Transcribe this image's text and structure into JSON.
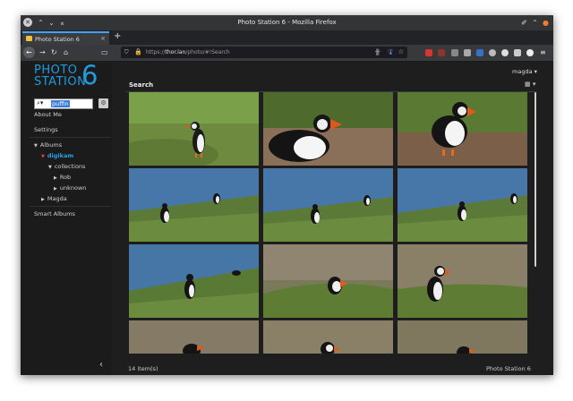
{
  "window": {
    "title": "Photo Station 6 - Mozilla Firefox"
  },
  "browser": {
    "tab_label": "Photo Station 6",
    "tab_close": "×",
    "new_tab": "+",
    "url_prefix": "https://",
    "url_host": "thor.lan",
    "url_path": "/photo/#!Search",
    "icons": [
      "back-icon",
      "forward-icon",
      "reload-icon",
      "home-icon",
      "reader-icon",
      "shield-icon",
      "lock-icon",
      "page-actions-icon",
      "pocket-icon",
      "bookmark-star-icon",
      "library-icon",
      "sidebar-icon",
      "downloads-icon",
      "menu-icon"
    ]
  },
  "sidebar": {
    "logo_text": "PHOTO\nSTATION",
    "logo_number": "6",
    "search_value": "puffin",
    "links": [
      "About Me",
      "Settings"
    ],
    "tree": [
      {
        "label": "Albums",
        "depth": 0,
        "expanded": true,
        "active": false
      },
      {
        "label": "digikam",
        "depth": 1,
        "expanded": true,
        "active": true
      },
      {
        "label": "collections",
        "depth": 2,
        "expanded": true,
        "active": false
      },
      {
        "label": "Rob",
        "depth": 3,
        "expanded": false,
        "active": false
      },
      {
        "label": "unknown",
        "depth": 3,
        "expanded": false,
        "active": false
      },
      {
        "label": "Magda",
        "depth": 1,
        "expanded": false,
        "active": false
      }
    ],
    "smart_albums": "Smart Albums",
    "collapse_glyph": "‹"
  },
  "main": {
    "title": "Search",
    "user": "magda ▾",
    "view_toggle": "▦ ▾",
    "photos": [
      {
        "desc": "puffin standing on grass"
      },
      {
        "desc": "puffin close-up on rocks"
      },
      {
        "desc": "puffin on cliff edge"
      },
      {
        "desc": "puffins on grassy cliff by sea"
      },
      {
        "desc": "puffins on grassy cliff by sea"
      },
      {
        "desc": "puffins on grassy cliff by sea"
      },
      {
        "desc": "puffin on cliff by sea"
      },
      {
        "desc": "puffin in grass, blurred"
      },
      {
        "desc": "puffin in grass"
      },
      {
        "desc": "puffin partial"
      },
      {
        "desc": "puffin partial"
      },
      {
        "desc": "puffin partial"
      }
    ],
    "footer_count": "14 item(s)",
    "footer_brand": "Photo Station 6"
  },
  "colors": {
    "accent": "#1f9bde",
    "bg": "#1e1e1e"
  }
}
